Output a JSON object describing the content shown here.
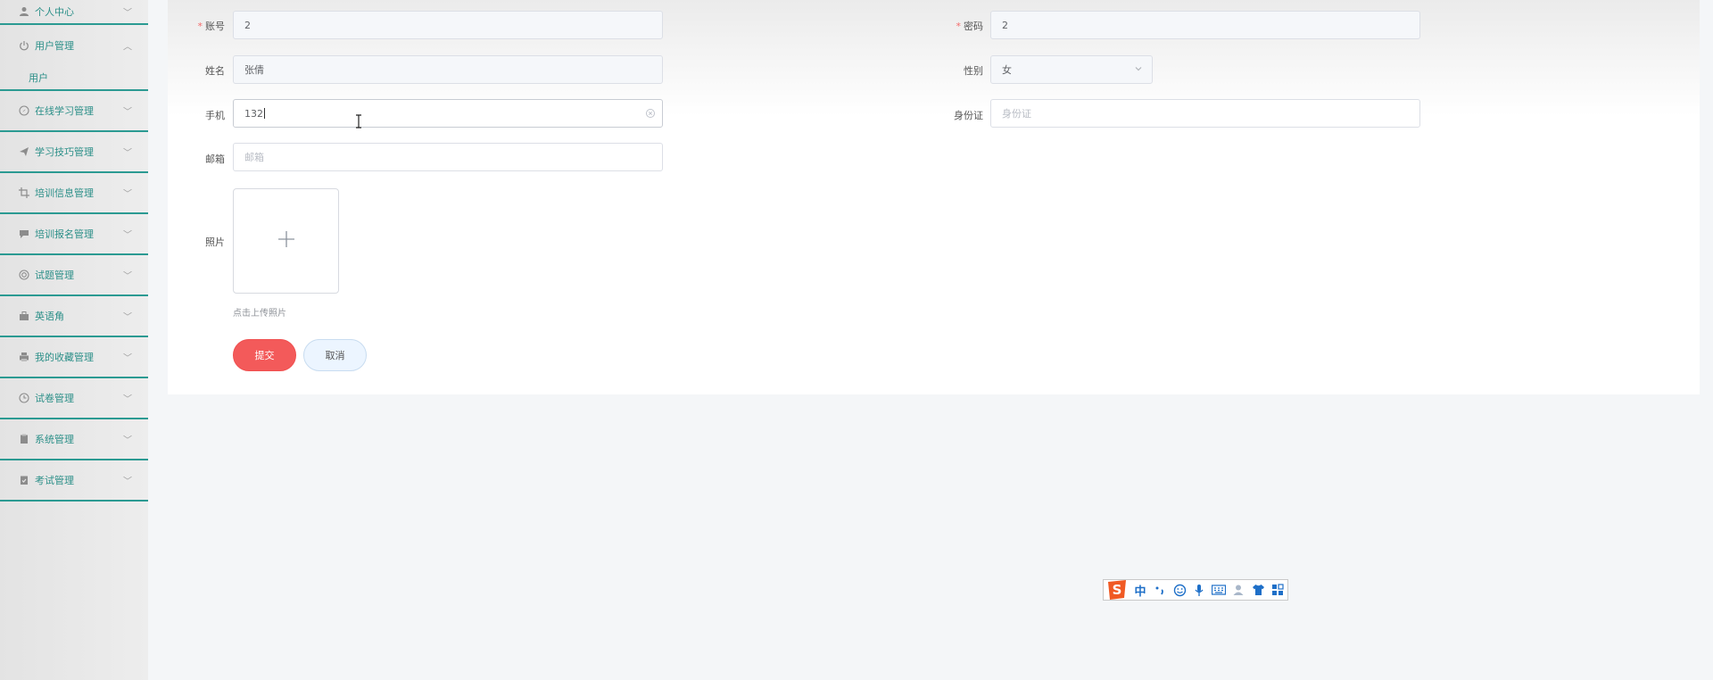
{
  "sidebar": {
    "items": [
      {
        "label": "个人中心",
        "icon": "user-icon"
      },
      {
        "label": "用户管理",
        "icon": "power-icon"
      },
      {
        "label": "在线学习管理",
        "icon": "compass-icon"
      },
      {
        "label": "学习技巧管理",
        "icon": "send-icon"
      },
      {
        "label": "培训信息管理",
        "icon": "crop-icon"
      },
      {
        "label": "培训报名管理",
        "icon": "comment-icon"
      },
      {
        "label": "试题管理",
        "icon": "help-circle-icon"
      },
      {
        "label": "英语角",
        "icon": "briefcase-icon"
      },
      {
        "label": "我的收藏管理",
        "icon": "printer-icon"
      },
      {
        "label": "试卷管理",
        "icon": "clock-icon"
      },
      {
        "label": "系统管理",
        "icon": "document-icon"
      },
      {
        "label": "考试管理",
        "icon": "clipboard-icon"
      }
    ],
    "submenu": {
      "label": "用户"
    }
  },
  "form": {
    "account": {
      "label": "账号",
      "value": "2"
    },
    "password": {
      "label": "密码",
      "value": "2"
    },
    "name": {
      "label": "姓名",
      "value": "张倩"
    },
    "gender": {
      "label": "性别",
      "value": "女"
    },
    "phone": {
      "label": "手机",
      "value": "132"
    },
    "idcard": {
      "label": "身份证",
      "placeholder": "身份证"
    },
    "email": {
      "label": "邮箱",
      "placeholder": "邮箱"
    },
    "photo": {
      "label": "照片",
      "hint": "点击上传照片"
    },
    "submit_label": "提交",
    "cancel_label": "取消"
  },
  "ime": {
    "mode": "中"
  },
  "colors": {
    "accent": "#2b9a92",
    "submit": "#f35a5a",
    "required": "#f56c6c"
  }
}
